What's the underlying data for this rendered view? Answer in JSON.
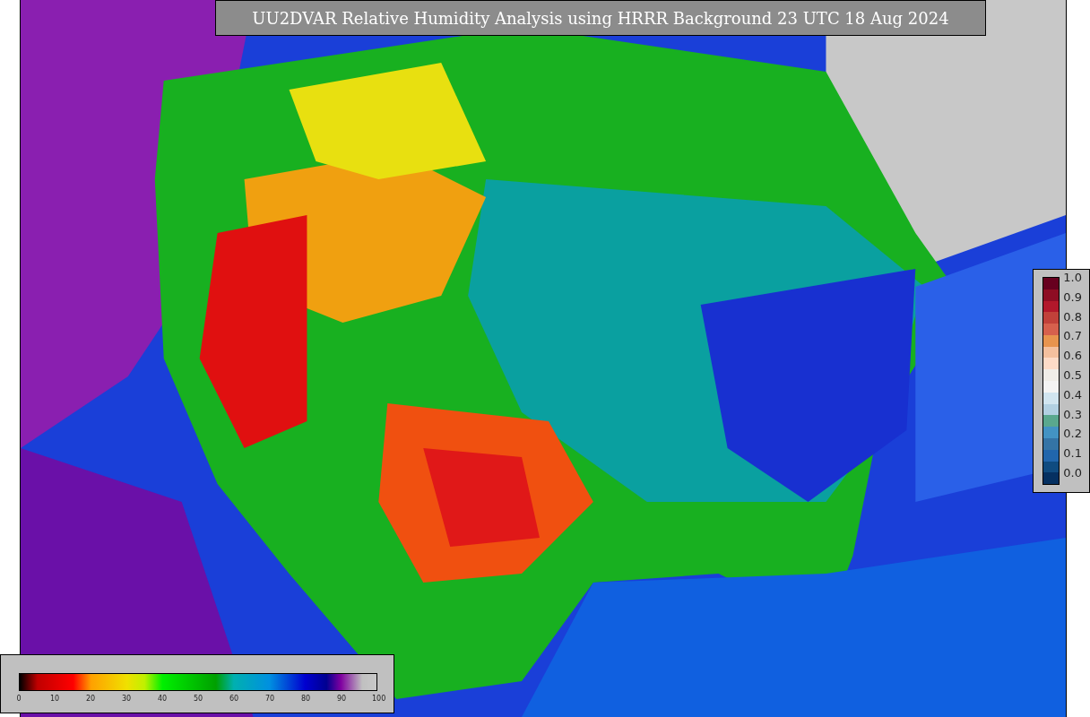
{
  "title": "UU2DVAR Relative Humidity Analysis using HRRR Background 23 UTC 18 Aug 2024",
  "weight_colorbar": {
    "tick_labels": [
      "1.0",
      "0.9",
      "0.8",
      "0.7",
      "0.6",
      "0.5",
      "0.4",
      "0.3",
      "0.2",
      "0.1",
      "0.0"
    ]
  },
  "humidity_colorbar": {
    "tick_labels": [
      "0",
      "10",
      "20",
      "30",
      "40",
      "50",
      "60",
      "70",
      "80",
      "90",
      "100"
    ]
  }
}
